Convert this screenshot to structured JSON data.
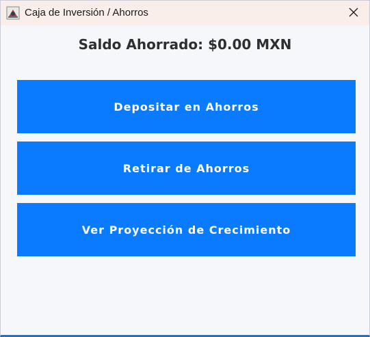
{
  "window": {
    "title": "Caja de Inversión / Ahorros",
    "icon": "java-app-icon",
    "close_icon": "close-icon"
  },
  "balance": {
    "label": "Saldo Ahorrado: $0.00 MXN"
  },
  "actions": {
    "deposit_label": "Depositar en Ahorros",
    "withdraw_label": "Retirar de Ahorros",
    "projection_label": "Ver Proyección de Crecimiento"
  },
  "colors": {
    "button_bg": "#0a7bff",
    "button_text": "#ffffff",
    "window_bg": "#f5f7fb",
    "titlebar_bg": "#f9eeea"
  }
}
